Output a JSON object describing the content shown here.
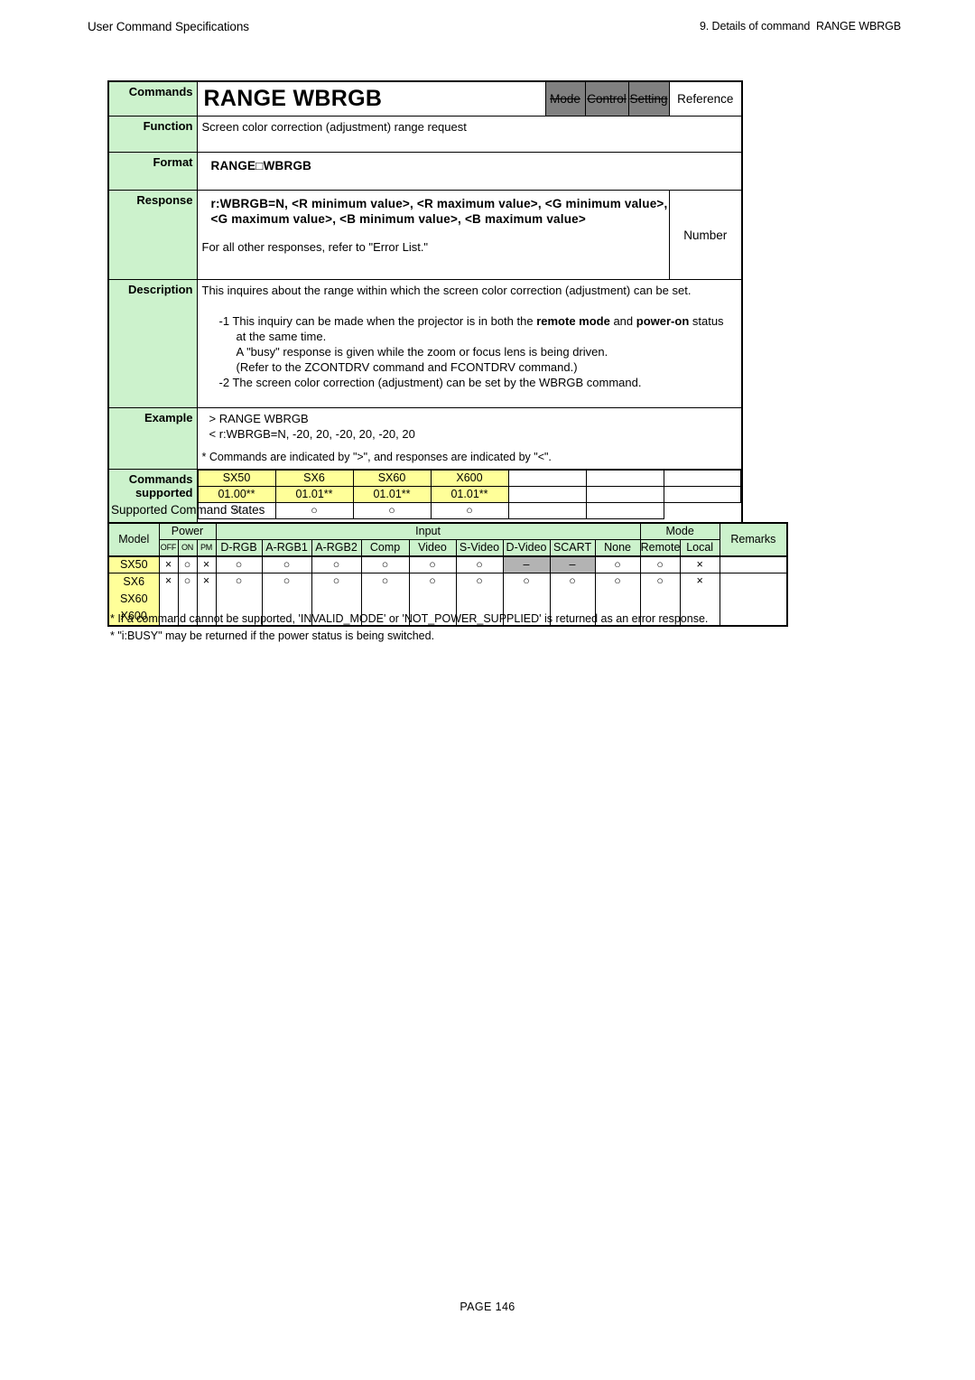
{
  "header": {
    "left": "User Command Specifications",
    "right": "9. Details of command  RANGE WBRGB"
  },
  "command": {
    "commands_label": "Commands",
    "title": "RANGE WBRGB",
    "tags": [
      {
        "label": "Mode",
        "active": false
      },
      {
        "label": "Control",
        "active": false
      },
      {
        "label": "Setting",
        "active": false
      },
      {
        "label": "Reference",
        "active": true
      }
    ],
    "function_label": "Function",
    "function_text": "Screen color correction (adjustment) range request",
    "format_label": "Format",
    "format_text": "RANGE□WBRGB",
    "response_label": "Response",
    "response_line1": "r:WBRGB=N, <R minimum value>, <R maximum value>, <G minimum value>,",
    "response_line2": "<G maximum value>, <B minimum value>, <B maximum value>",
    "response_line3": "For all other responses, refer to \"Error List.\"",
    "response_type": "Number",
    "description_label": "Description",
    "description_intro": "This inquires about the range within which the screen color correction (adjustment) can be set.",
    "description_items": [
      {
        "marker": "-1",
        "line1_a": "This inquiry can be made when the projector is in both the ",
        "line1_b": "remote mode",
        "line1_c": " and ",
        "line1_d": "power-on",
        "line1_e": " status",
        "line2": "at the same time.",
        "line3": "A \"busy\" response is given while the zoom or focus lens is being driven.",
        "line4": "(Refer to the ZCONTDRV command and FCONTDRV command.)"
      },
      {
        "marker": "-2",
        "line1_a": "The screen color correction (adjustment) can be set by the WBRGB command."
      }
    ],
    "example_label": "Example",
    "example_line1": "> RANGE WBRGB",
    "example_line2": "< r:WBRGB=N, -20, 20, -20, 20, -20, 20",
    "example_note": "* Commands are indicated by \">\", and responses are indicated by \"<\".",
    "supported_label_line1": "Commands",
    "supported_label_line2": "supported",
    "supported_models": [
      {
        "model": "SX50",
        "version": "01.00**",
        "mark": "○"
      },
      {
        "model": "SX6",
        "version": "01.01**",
        "mark": "○"
      },
      {
        "model": "SX60",
        "version": "01.01**",
        "mark": "○"
      },
      {
        "model": "X600",
        "version": "01.01**",
        "mark": "○"
      },
      {
        "model": "",
        "version": "",
        "mark": ""
      },
      {
        "model": "",
        "version": "",
        "mark": ""
      },
      {
        "model": "",
        "version": "",
        "mark": ""
      }
    ]
  },
  "states": {
    "title": "Supported Command States",
    "group_headers": {
      "model": "Model",
      "power": "Power",
      "input": "Input",
      "mode": "Mode",
      "remarks": "Remarks"
    },
    "sub_headers": {
      "power": [
        "OFF",
        "ON",
        "PM"
      ],
      "input": [
        "D-RGB",
        "A-RGB1",
        "A-RGB2",
        "Comp",
        "Video",
        "S-Video",
        "D-Video",
        "SCART",
        "None"
      ],
      "mode": [
        "Remote",
        "Local"
      ]
    },
    "rows": [
      {
        "models": [
          "SX50"
        ],
        "power": [
          "×",
          "○",
          "×"
        ],
        "input": [
          "○",
          "○",
          "○",
          "○",
          "○",
          "○",
          "–",
          "–",
          "○"
        ],
        "input_gray": [
          false,
          false,
          false,
          false,
          false,
          false,
          true,
          true,
          false
        ],
        "mode": [
          "○",
          "×"
        ],
        "remarks": ""
      },
      {
        "models": [
          "SX6",
          "SX60",
          "X600"
        ],
        "power": [
          "×",
          "○",
          "×"
        ],
        "input": [
          "○",
          "○",
          "○",
          "○",
          "○",
          "○",
          "○",
          "○",
          "○"
        ],
        "input_gray": [
          false,
          false,
          false,
          false,
          false,
          false,
          false,
          false,
          false
        ],
        "mode": [
          "○",
          "×"
        ],
        "remarks": ""
      }
    ],
    "footnotes": [
      "* If a command cannot be supported, 'INVALID_MODE' or 'NOT_POWER_SUPPLIED' is returned as an error response.",
      "* \"i:BUSY\" may be returned if the power status is being switched."
    ]
  },
  "footer": {
    "page": "PAGE 146"
  }
}
